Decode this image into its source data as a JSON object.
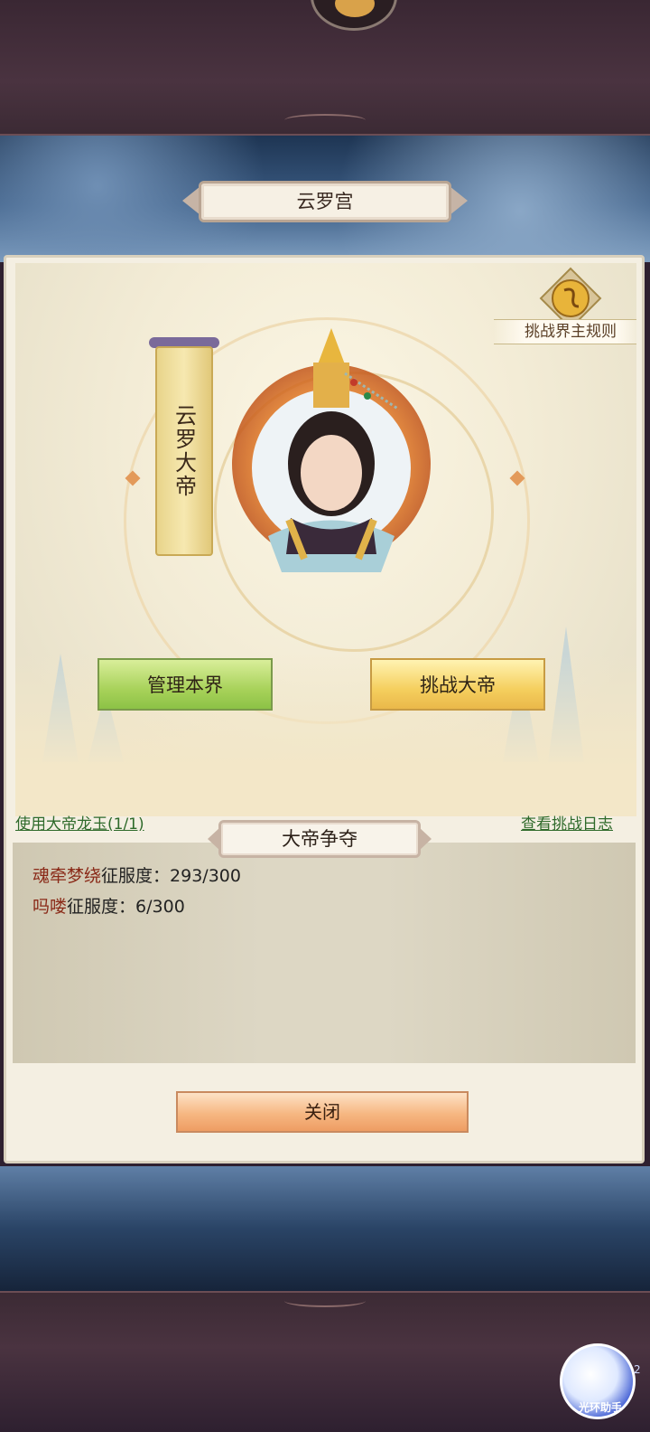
{
  "palace_title": "云罗宫",
  "rules_button": {
    "label": "挑战界主规则",
    "icon": "scroll-seal-icon"
  },
  "emperor_banner": "云罗大帝",
  "portrait": "emperor-portrait",
  "buttons": {
    "manage": "管理本界",
    "challenge": "挑战大帝",
    "close": "关闭"
  },
  "links": {
    "use_jade_label": "使用大帝龙玉",
    "use_jade_count": "(1/1)",
    "view_log": "查看挑战日志"
  },
  "section_title": "大帝争夺",
  "conquest_list": [
    {
      "name": "魂牵梦绕",
      "label": "征服度：",
      "value": "293/300"
    },
    {
      "name": "吗喽",
      "label": "征服度：",
      "value": "6/300"
    }
  ],
  "assistant": {
    "label": "光环助手",
    "badge": "2"
  },
  "colors": {
    "green_button": "#a8d25a",
    "gold_button": "#f5cf5e",
    "close_button": "#f6b782",
    "link": "#2e6a2a",
    "player_name": "#8a2a18"
  }
}
